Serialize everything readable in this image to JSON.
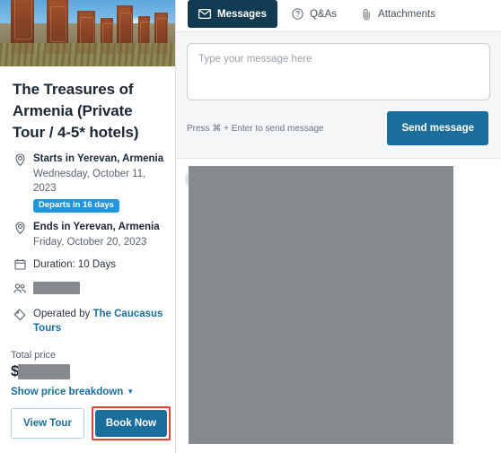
{
  "sidebar": {
    "hero_image": {
      "alt": "armenian-khachkar-stones-photo"
    },
    "title": "The Treasures of Armenia (Private Tour / 4-5* hotels)",
    "details": [
      {
        "icon": "location-pin-icon",
        "strong": "Starts in Yerevan, Armenia",
        "sub": "Wednesday, October 11, 2023",
        "badge": "Departs in 16 days"
      },
      {
        "icon": "location-pin-icon",
        "strong": "Ends in Yerevan, Armenia",
        "sub": "Friday, October 20, 2023"
      },
      {
        "icon": "calendar-icon",
        "plain": "Duration: 10 Days"
      },
      {
        "icon": "travelers-icon",
        "plain": "",
        "redacted": true
      },
      {
        "icon": "tag-icon",
        "plain_prefix": "Operated by ",
        "link": "The Caucasus Tours"
      }
    ],
    "price": {
      "label": "Total price",
      "currency_symbol": "$",
      "amount_redacted": true,
      "breakdown_label": "Show price breakdown",
      "caret": "▼"
    },
    "actions": {
      "view_tour": "View Tour",
      "book_now": "Book Now",
      "book_now_highlight_color": "#e8402a"
    }
  },
  "right_panel": {
    "tabs": [
      {
        "label": "Messages",
        "icon": "envelope-icon",
        "active": true
      },
      {
        "label": "Q&As",
        "icon": "question-circle-icon",
        "active": false
      },
      {
        "label": "Attachments",
        "icon": "paperclip-icon",
        "active": false
      }
    ],
    "composer": {
      "placeholder": "Type your message here",
      "value": "",
      "hint": "Press ⌘ + Enter to send message",
      "send_label": "Send message"
    },
    "thread": {
      "redacted": true
    }
  },
  "colors": {
    "primary_blue": "#1b6e9b",
    "tab_active_navy": "#123a52",
    "badge_blue": "#2196e0",
    "highlight_red": "#e8402a",
    "redaction_gray": "#878a8d",
    "composer_bg": "#f4f6f8"
  }
}
